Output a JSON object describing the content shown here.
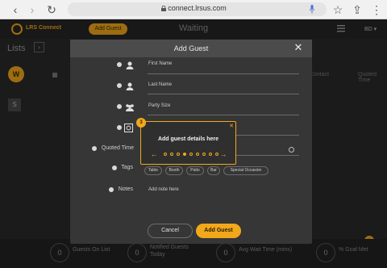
{
  "browser": {
    "url": "connect.lrsus.com"
  },
  "app": {
    "logo_text": "LRS Connect",
    "add_guest_pill": "Add Guest",
    "header_title": "Waiting",
    "user_menu": "BD",
    "lists_label": "Lists",
    "side_items": [
      "W",
      "S"
    ],
    "col_hints": [
      "Contact",
      "Quoted Time"
    ]
  },
  "stats": [
    {
      "value": "0",
      "label": "Guests On List"
    },
    {
      "value": "0",
      "label": "Notified Guests Today"
    },
    {
      "value": "0",
      "label": "Avg Wait Time (mins)"
    },
    {
      "value": "0",
      "label": "% Goal Met"
    }
  ],
  "modal": {
    "title": "Add Guest",
    "fields": {
      "first_name": "First Name",
      "last_name": "Last Name",
      "party_size": "Party Size",
      "quoted_time": "Quoted Time",
      "tags": "Tags",
      "notes": "Notes",
      "notes_placeholder": "Add note here"
    },
    "tags": [
      "Table",
      "Booth",
      "Patio",
      "Bar",
      "Special Occasion"
    ],
    "cancel": "Cancel",
    "add": "Add Guest"
  },
  "tip": {
    "step": "3",
    "title": "Add guest details here",
    "total_dots": 9,
    "active_dot": 3,
    "accent": "#f1a81b"
  }
}
